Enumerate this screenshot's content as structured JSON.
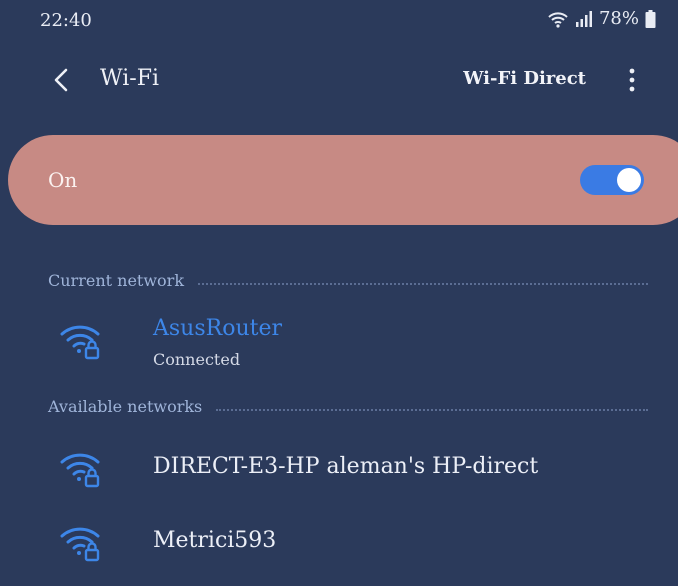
{
  "status_bar": {
    "time": "22:40",
    "battery_text": "78%",
    "icons": [
      "wifi-signal-icon",
      "cell-signal-icon",
      "battery-icon"
    ]
  },
  "header": {
    "title": "Wi-Fi",
    "wifi_direct_label": "Wi-Fi Direct",
    "icons": [
      "back-chevron-icon",
      "more-vertical-icon"
    ]
  },
  "wifi_toggle": {
    "label": "On",
    "enabled": true
  },
  "current_network": {
    "section_title": "Current network",
    "name": "AsusRouter",
    "status": "Connected",
    "icon": "wifi-lock-icon"
  },
  "available_networks": {
    "section_title": "Available networks",
    "items": [
      {
        "name": "DIRECT-E3-HP aleman's HP-direct",
        "icon": "wifi-lock-icon"
      },
      {
        "name": "Metrici593",
        "icon": "wifi-lock-icon"
      }
    ]
  },
  "colors": {
    "background": "#2b3a5b",
    "banner": "#c78a84",
    "accent": "#3d86e8",
    "section_text": "#9fb4d9"
  }
}
